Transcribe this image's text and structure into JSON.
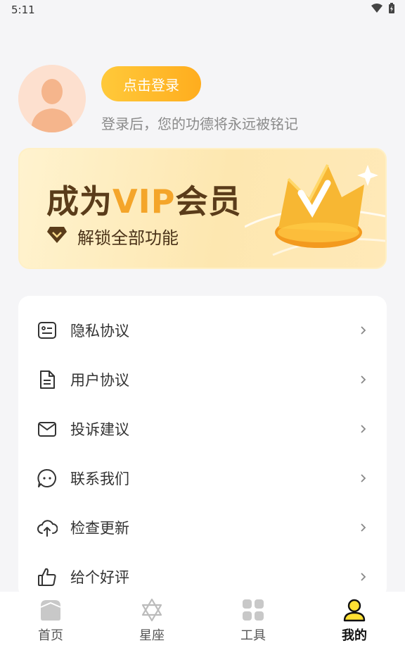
{
  "status_bar": {
    "time": "5:11"
  },
  "profile": {
    "login_button": "点击登录",
    "subtitle": "登录后，您的功德将永远被铭记"
  },
  "vip_banner": {
    "title_prefix": "成为",
    "title_vip": "VIP",
    "title_suffix": "会员",
    "subtitle": "解锁全部功能"
  },
  "menu": {
    "items": [
      {
        "label": "隐私协议",
        "icon": "privacy-icon"
      },
      {
        "label": "用户协议",
        "icon": "document-icon"
      },
      {
        "label": "投诉建议",
        "icon": "mail-icon"
      },
      {
        "label": "联系我们",
        "icon": "chat-icon"
      },
      {
        "label": "检查更新",
        "icon": "cloud-upload-icon"
      },
      {
        "label": "给个好评",
        "icon": "thumbs-up-icon"
      }
    ]
  },
  "tabbar": {
    "tabs": [
      {
        "label": "首页",
        "icon": "home-icon"
      },
      {
        "label": "星座",
        "icon": "star-of-david-icon"
      },
      {
        "label": "工具",
        "icon": "grid-icon"
      },
      {
        "label": "我的",
        "icon": "user-icon",
        "active": true
      }
    ]
  },
  "colors": {
    "accent": "#ffb81f",
    "vip_gold": "#f4a52a",
    "vip_brown": "#5a3c1a",
    "background": "#f5f5f7"
  }
}
